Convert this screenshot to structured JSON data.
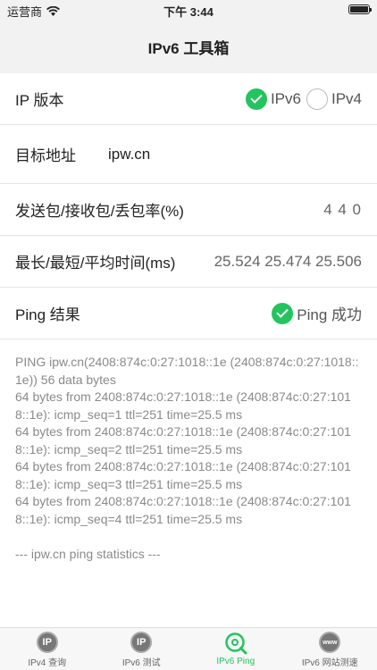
{
  "status": {
    "carrier": "运营商",
    "time": "下午 3:44"
  },
  "nav": {
    "title": "IPv6 工具箱"
  },
  "rows": {
    "ip_version": {
      "label": "IP 版本",
      "options": [
        "IPv6",
        "IPv4"
      ],
      "selected": "IPv6"
    },
    "target": {
      "label": "目标地址",
      "value": "ipw.cn"
    },
    "packets": {
      "label": "发送包/接收包/丢包率(%)",
      "value": "4 4 0"
    },
    "timing": {
      "label": "最长/最短/平均时间(ms)",
      "value": "25.524 25.474 25.506"
    },
    "ping_result": {
      "label": "Ping 结果",
      "value": "Ping 成功"
    }
  },
  "log": [
    "PING ipw.cn(2408:874c:0:27:1018::1e (2408:874c:0:27:1018::1e)) 56 data bytes",
    "64 bytes from 2408:874c:0:27:1018::1e (2408:874c:0:27:1018::1e): icmp_seq=1 ttl=251 time=25.5 ms",
    "64 bytes from 2408:874c:0:27:1018::1e (2408:874c:0:27:1018::1e): icmp_seq=2 ttl=251 time=25.5 ms",
    "64 bytes from 2408:874c:0:27:1018::1e (2408:874c:0:27:1018::1e): icmp_seq=3 ttl=251 time=25.5 ms",
    "64 bytes from 2408:874c:0:27:1018::1e (2408:874c:0:27:1018::1e): icmp_seq=4 ttl=251 time=25.5 ms",
    "",
    "--- ipw.cn ping statistics ---"
  ],
  "tabs": [
    {
      "label": "IPv4 查询",
      "icon": "IP",
      "icon_name": "ip-icon",
      "active": false
    },
    {
      "label": "IPv6 测试",
      "icon": "IP",
      "icon_name": "ip-icon",
      "active": false
    },
    {
      "label": "IPv6 Ping",
      "icon": "",
      "icon_name": "ping-search-icon",
      "active": true
    },
    {
      "label": "IPv6 网站测速",
      "icon": "www",
      "icon_name": "www-icon",
      "active": false
    }
  ],
  "colors": {
    "accent": "#23c45e"
  }
}
